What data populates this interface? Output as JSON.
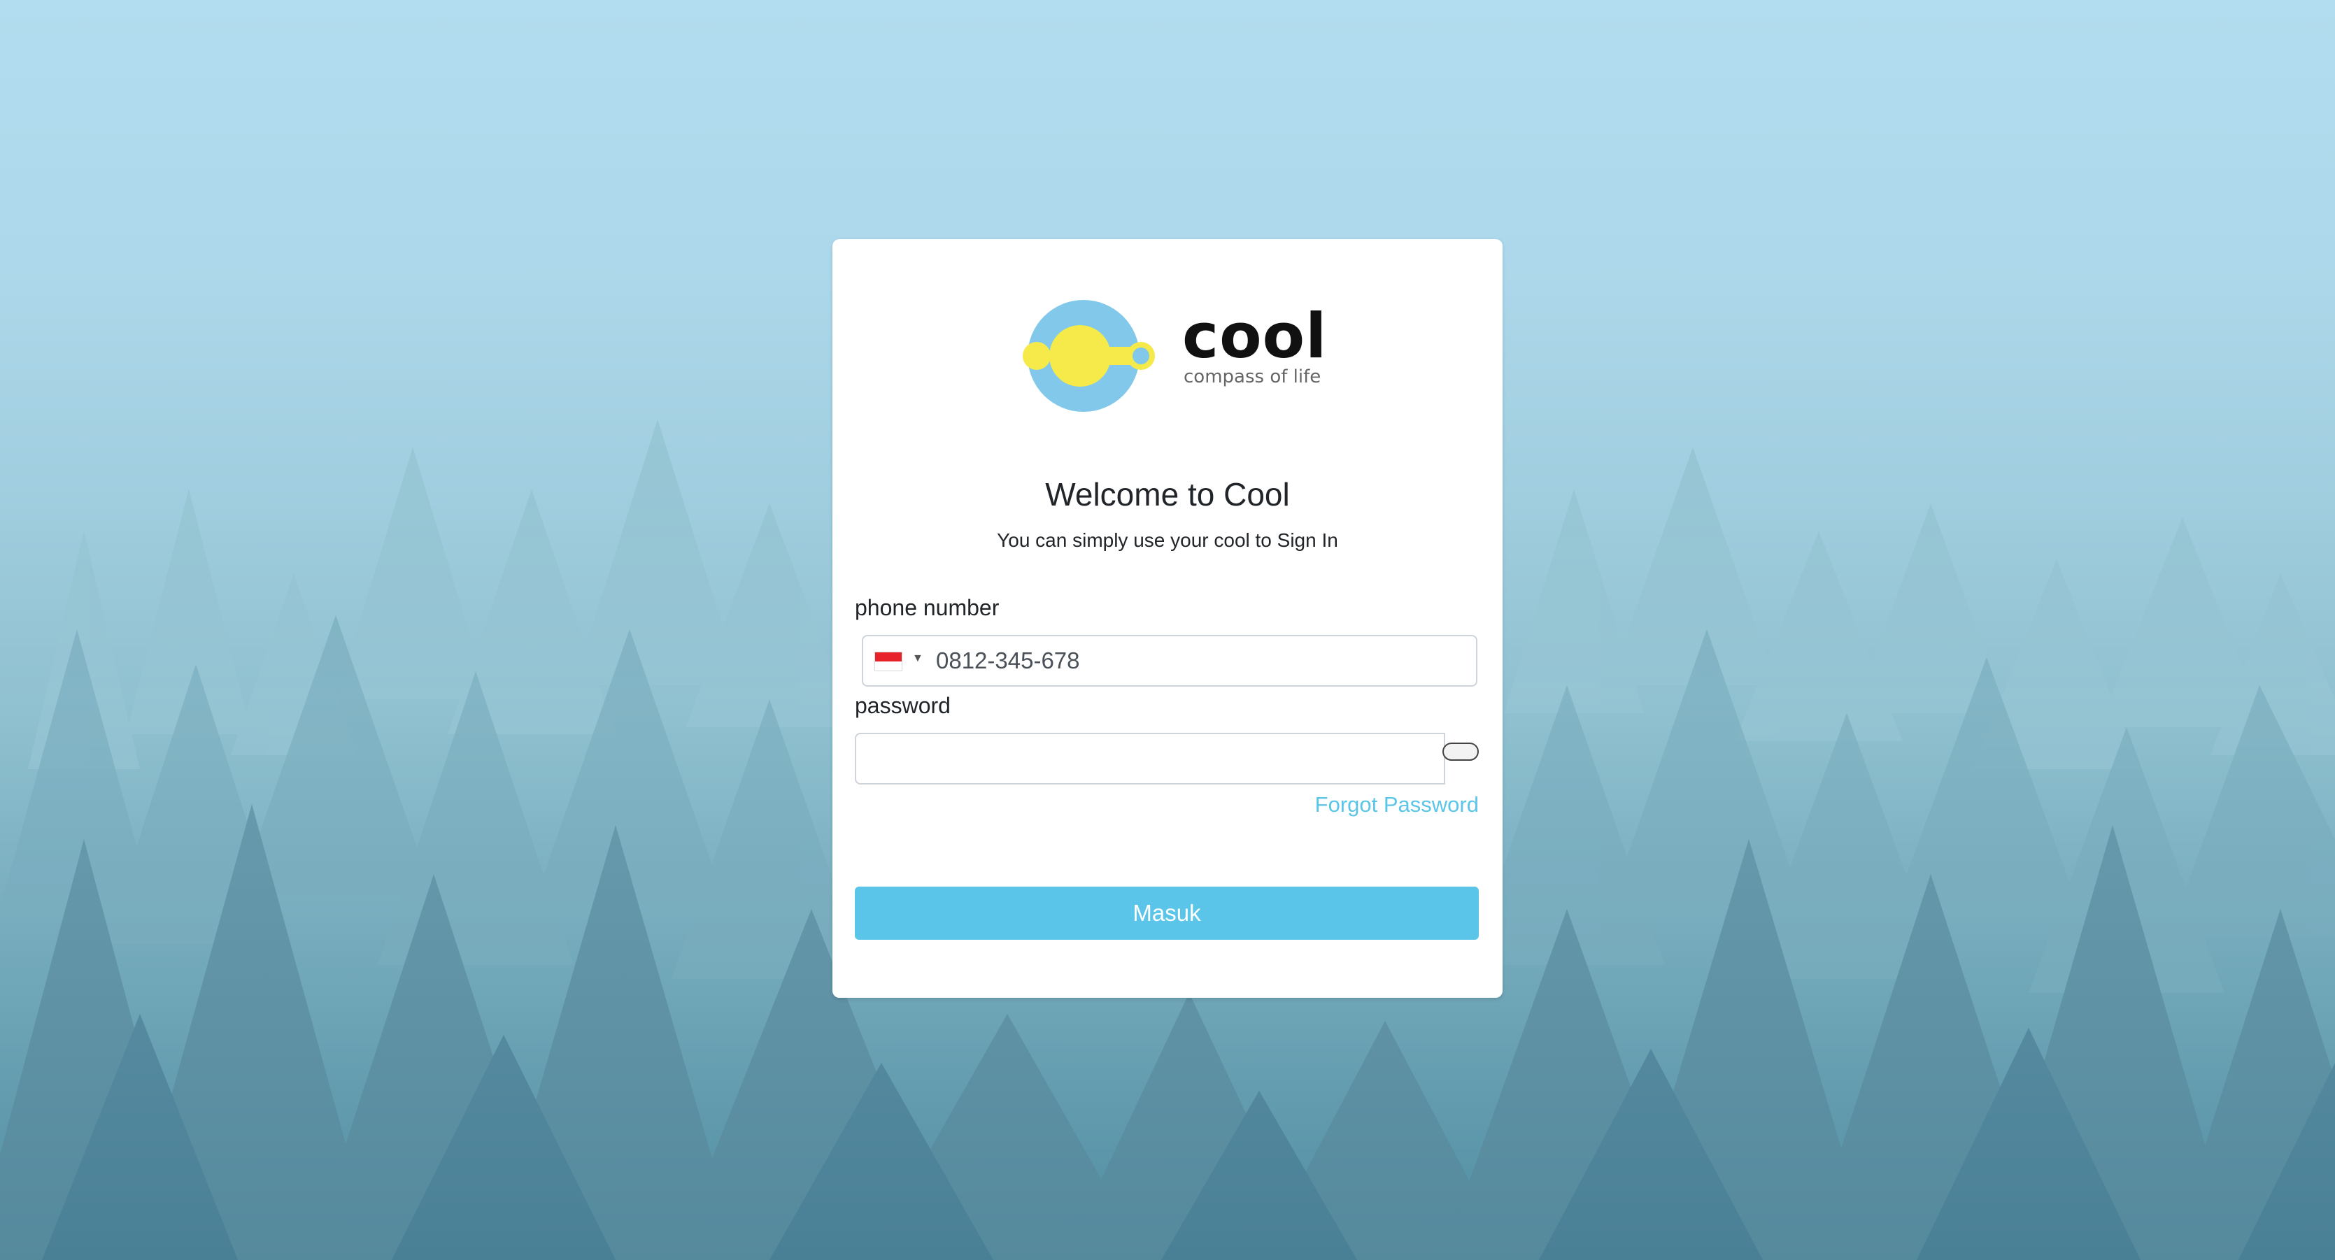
{
  "brand": {
    "name": "cool",
    "tagline": "compass of life"
  },
  "login": {
    "title": "Welcome to Cool",
    "subtitle": "You can simply use your cool to Sign In",
    "phone_label": "phone number",
    "phone_placeholder": "0812-345-678",
    "phone_country": "ID",
    "password_label": "password",
    "password_value": "",
    "forgot_password": "Forgot Password",
    "submit_label": "Masuk"
  },
  "colors": {
    "accent": "#5bc5e9",
    "logo_blue": "#82c8ea",
    "logo_yellow": "#f5ea4a",
    "flag_red": "#e8222a"
  }
}
